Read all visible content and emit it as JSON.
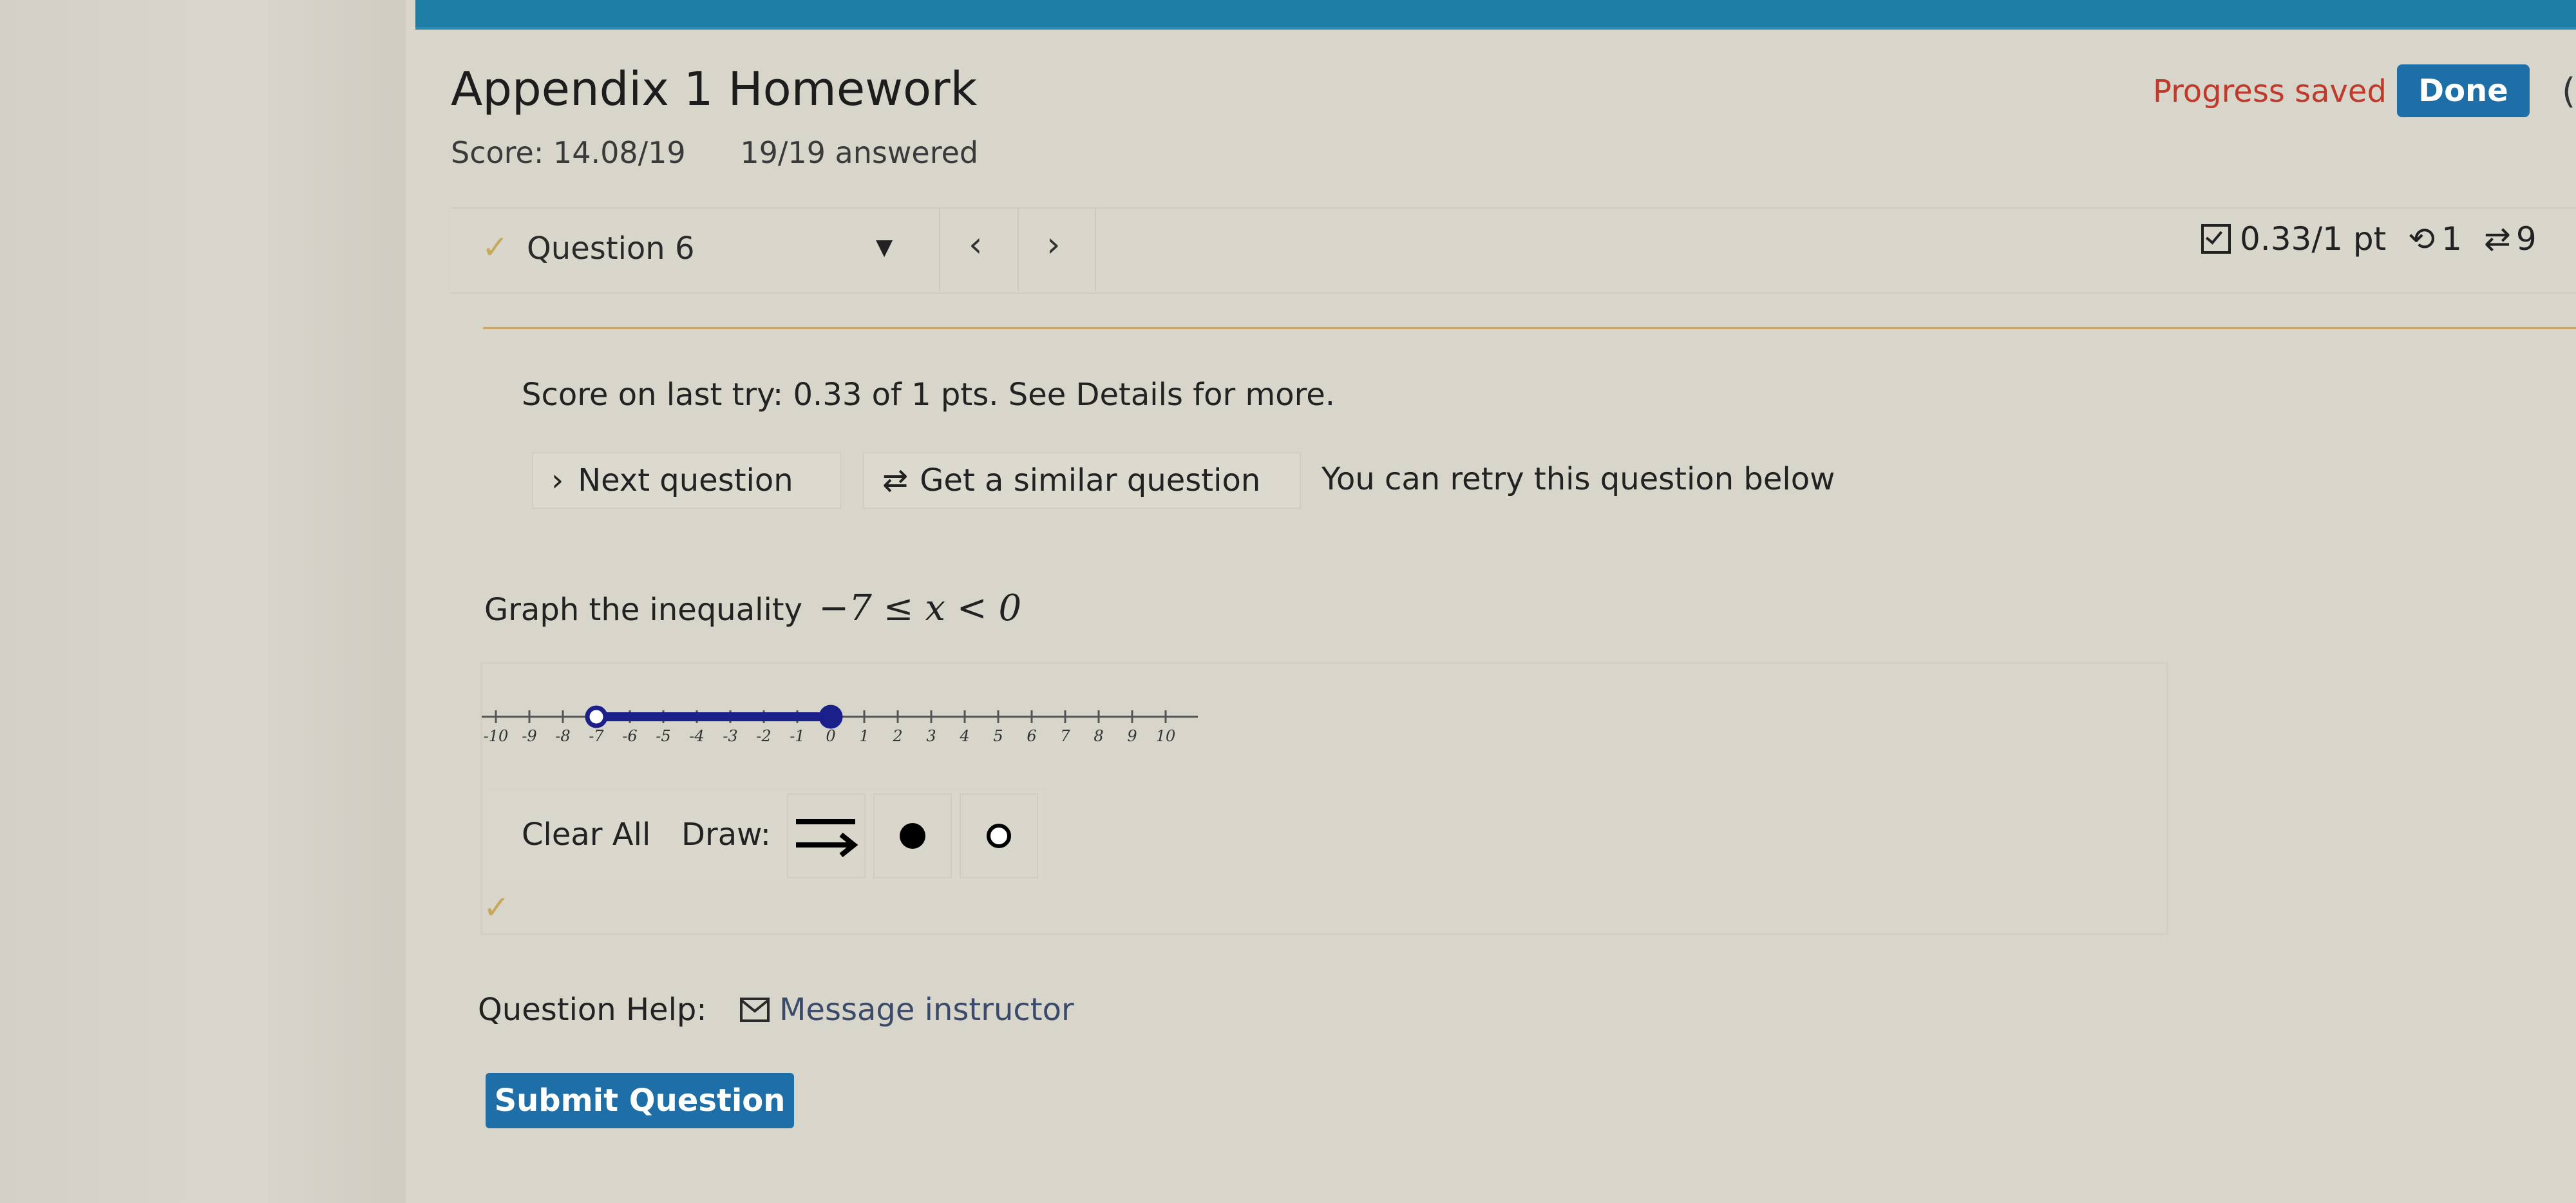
{
  "assignment": {
    "title": "Appendix 1 Homework",
    "score": "Score: 14.08/19",
    "answered": "19/19 answered",
    "progress_saved": "Progress saved",
    "done_label": "Done"
  },
  "question_bar": {
    "question_label": "Question 6",
    "points": "0.33/1 pt",
    "retries": "1",
    "similar_count": "9"
  },
  "feedback": {
    "last_try": "Score on last try: 0.33 of 1 pts. See Details for more.",
    "next_question": "Next question",
    "similar_question": "Get a similar question",
    "retry_note": "You can retry this question below"
  },
  "question": {
    "prompt": "Graph the inequality",
    "inequality": "−7 ≤ x < 0"
  },
  "number_line": {
    "ticks": [
      "-10",
      "-9",
      "-8",
      "-7",
      "-6",
      "-5",
      "-4",
      "-3",
      "-2",
      "-1",
      "0",
      "1",
      "2",
      "3",
      "4",
      "5",
      "6",
      "7",
      "8",
      "9",
      "10"
    ],
    "range": [
      -10,
      10
    ],
    "segment": {
      "start": -7,
      "end": 0,
      "start_closed": false,
      "end_closed": true
    }
  },
  "tools": {
    "clear_all": "Clear All",
    "draw_label": "Draw:"
  },
  "help": {
    "label": "Question Help:",
    "message_instructor": "Message instructor"
  },
  "submit_label": "Submit Question",
  "colors": {
    "accent_blue": "#1e6fa8",
    "top_bar": "#1f7ea6",
    "progress_red": "#c0392b",
    "segment_blue": "#1a1f8a",
    "divider_gold": "#c9a56a"
  }
}
